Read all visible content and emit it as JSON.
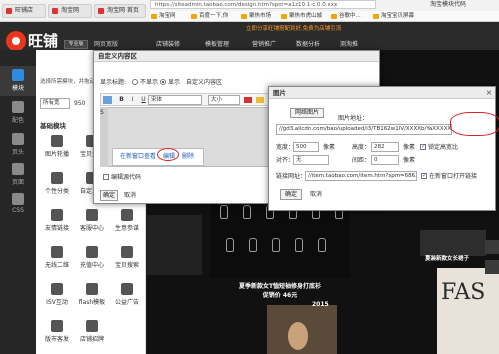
{
  "browser": {
    "tabs": [
      {
        "label": "旺铺店"
      },
      {
        "label": "淘宝网"
      },
      {
        "label": "淘宝网 首页"
      }
    ],
    "url": "https://siteadmin.taobao.com/design.htm?spm=a1z10.1-c.0.0.xxx",
    "bookmarks": [
      {
        "label": "淘宝网"
      },
      {
        "label": "百度一下,你"
      },
      {
        "label": "聚热市场"
      },
      {
        "label": "聚热市虎山城"
      },
      {
        "label": "谷歌中..."
      },
      {
        "label": "淘宝宝贝屏幕"
      }
    ],
    "ext_title": "淘宝模块代码"
  },
  "header": {
    "logo": "旺铺",
    "version": "专业版",
    "nav_dim": "网页宽版",
    "nav": [
      "店铺装修",
      "模板管理",
      "营销推广",
      "数据分析",
      "测淘推"
    ],
    "notice": "立即分享旺铺搭配到好,免费为店铺引流"
  },
  "iconcol": [
    {
      "label": "模块"
    },
    {
      "label": "配色"
    },
    {
      "label": "页头"
    },
    {
      "label": "页面"
    },
    {
      "label": "CSS"
    }
  ],
  "modpanel": {
    "hint": "选择所需模块，并拖动",
    "width_label": "所有宽",
    "width_value": "950",
    "section_title": "基础模块",
    "tiles": [
      [
        "图片轮播",
        "宝贝推荐",
        "宝贝分类"
      ],
      [
        "个性分类",
        "自定义区",
        "宝贝排行"
      ],
      [
        "友情链接",
        "客服中心",
        "生意参谋"
      ],
      [
        "无线二维",
        "充值中心",
        "宝贝搜索"
      ],
      [
        "ISV互动",
        "flash模板",
        "公益广告"
      ],
      [
        "版市客发",
        "店铺招牌",
        ""
      ]
    ]
  },
  "custom_dialog": {
    "title": "自定义内容区",
    "show_title_label": "显示标题:",
    "opt_no": "不显示",
    "opt_yes": "显示",
    "title_value": "自定义内容区",
    "font_value": "宋体",
    "size_value": "大小",
    "toolbar": [
      "B",
      "I",
      "U",
      "S"
    ],
    "link_open": "在新窗口查看",
    "link_edit": "编辑",
    "link_delete": "删除",
    "src_label": "编辑源代码",
    "ok": "确定",
    "cancel": "取消"
  },
  "image_dialog": {
    "title": "图片",
    "tab_web": "网络图片",
    "address_label": "图片地址：",
    "address_value": "//gd3.alicdn.com/bao/uploaded/i3/TB162w1lV/XXXXb/YaXXXXXXXXXX_!!0-item_pic.jpg",
    "width_label": "宽度：",
    "width_value": "500",
    "px": "像素",
    "height_label": "高度：",
    "height_value": "282",
    "lock_label": "锁定高宽比",
    "align_label": "对齐：",
    "align_value": "无",
    "spacing_label": "间距：",
    "spacing_value": "0",
    "link_label": "链接网址：",
    "link_value": "//item.taobao.com/item.htm?spm=686.10",
    "newwin_label": "在新窗口打开链接",
    "ok": "确定",
    "cancel": "取消"
  },
  "canvas": {
    "caption1": "夏季新款女T恤短袖修身打底衫",
    "price1": "促销价 46元",
    "caption2": "夏装新款女长裙子",
    "brand": "FAS",
    "badge": "2015"
  }
}
